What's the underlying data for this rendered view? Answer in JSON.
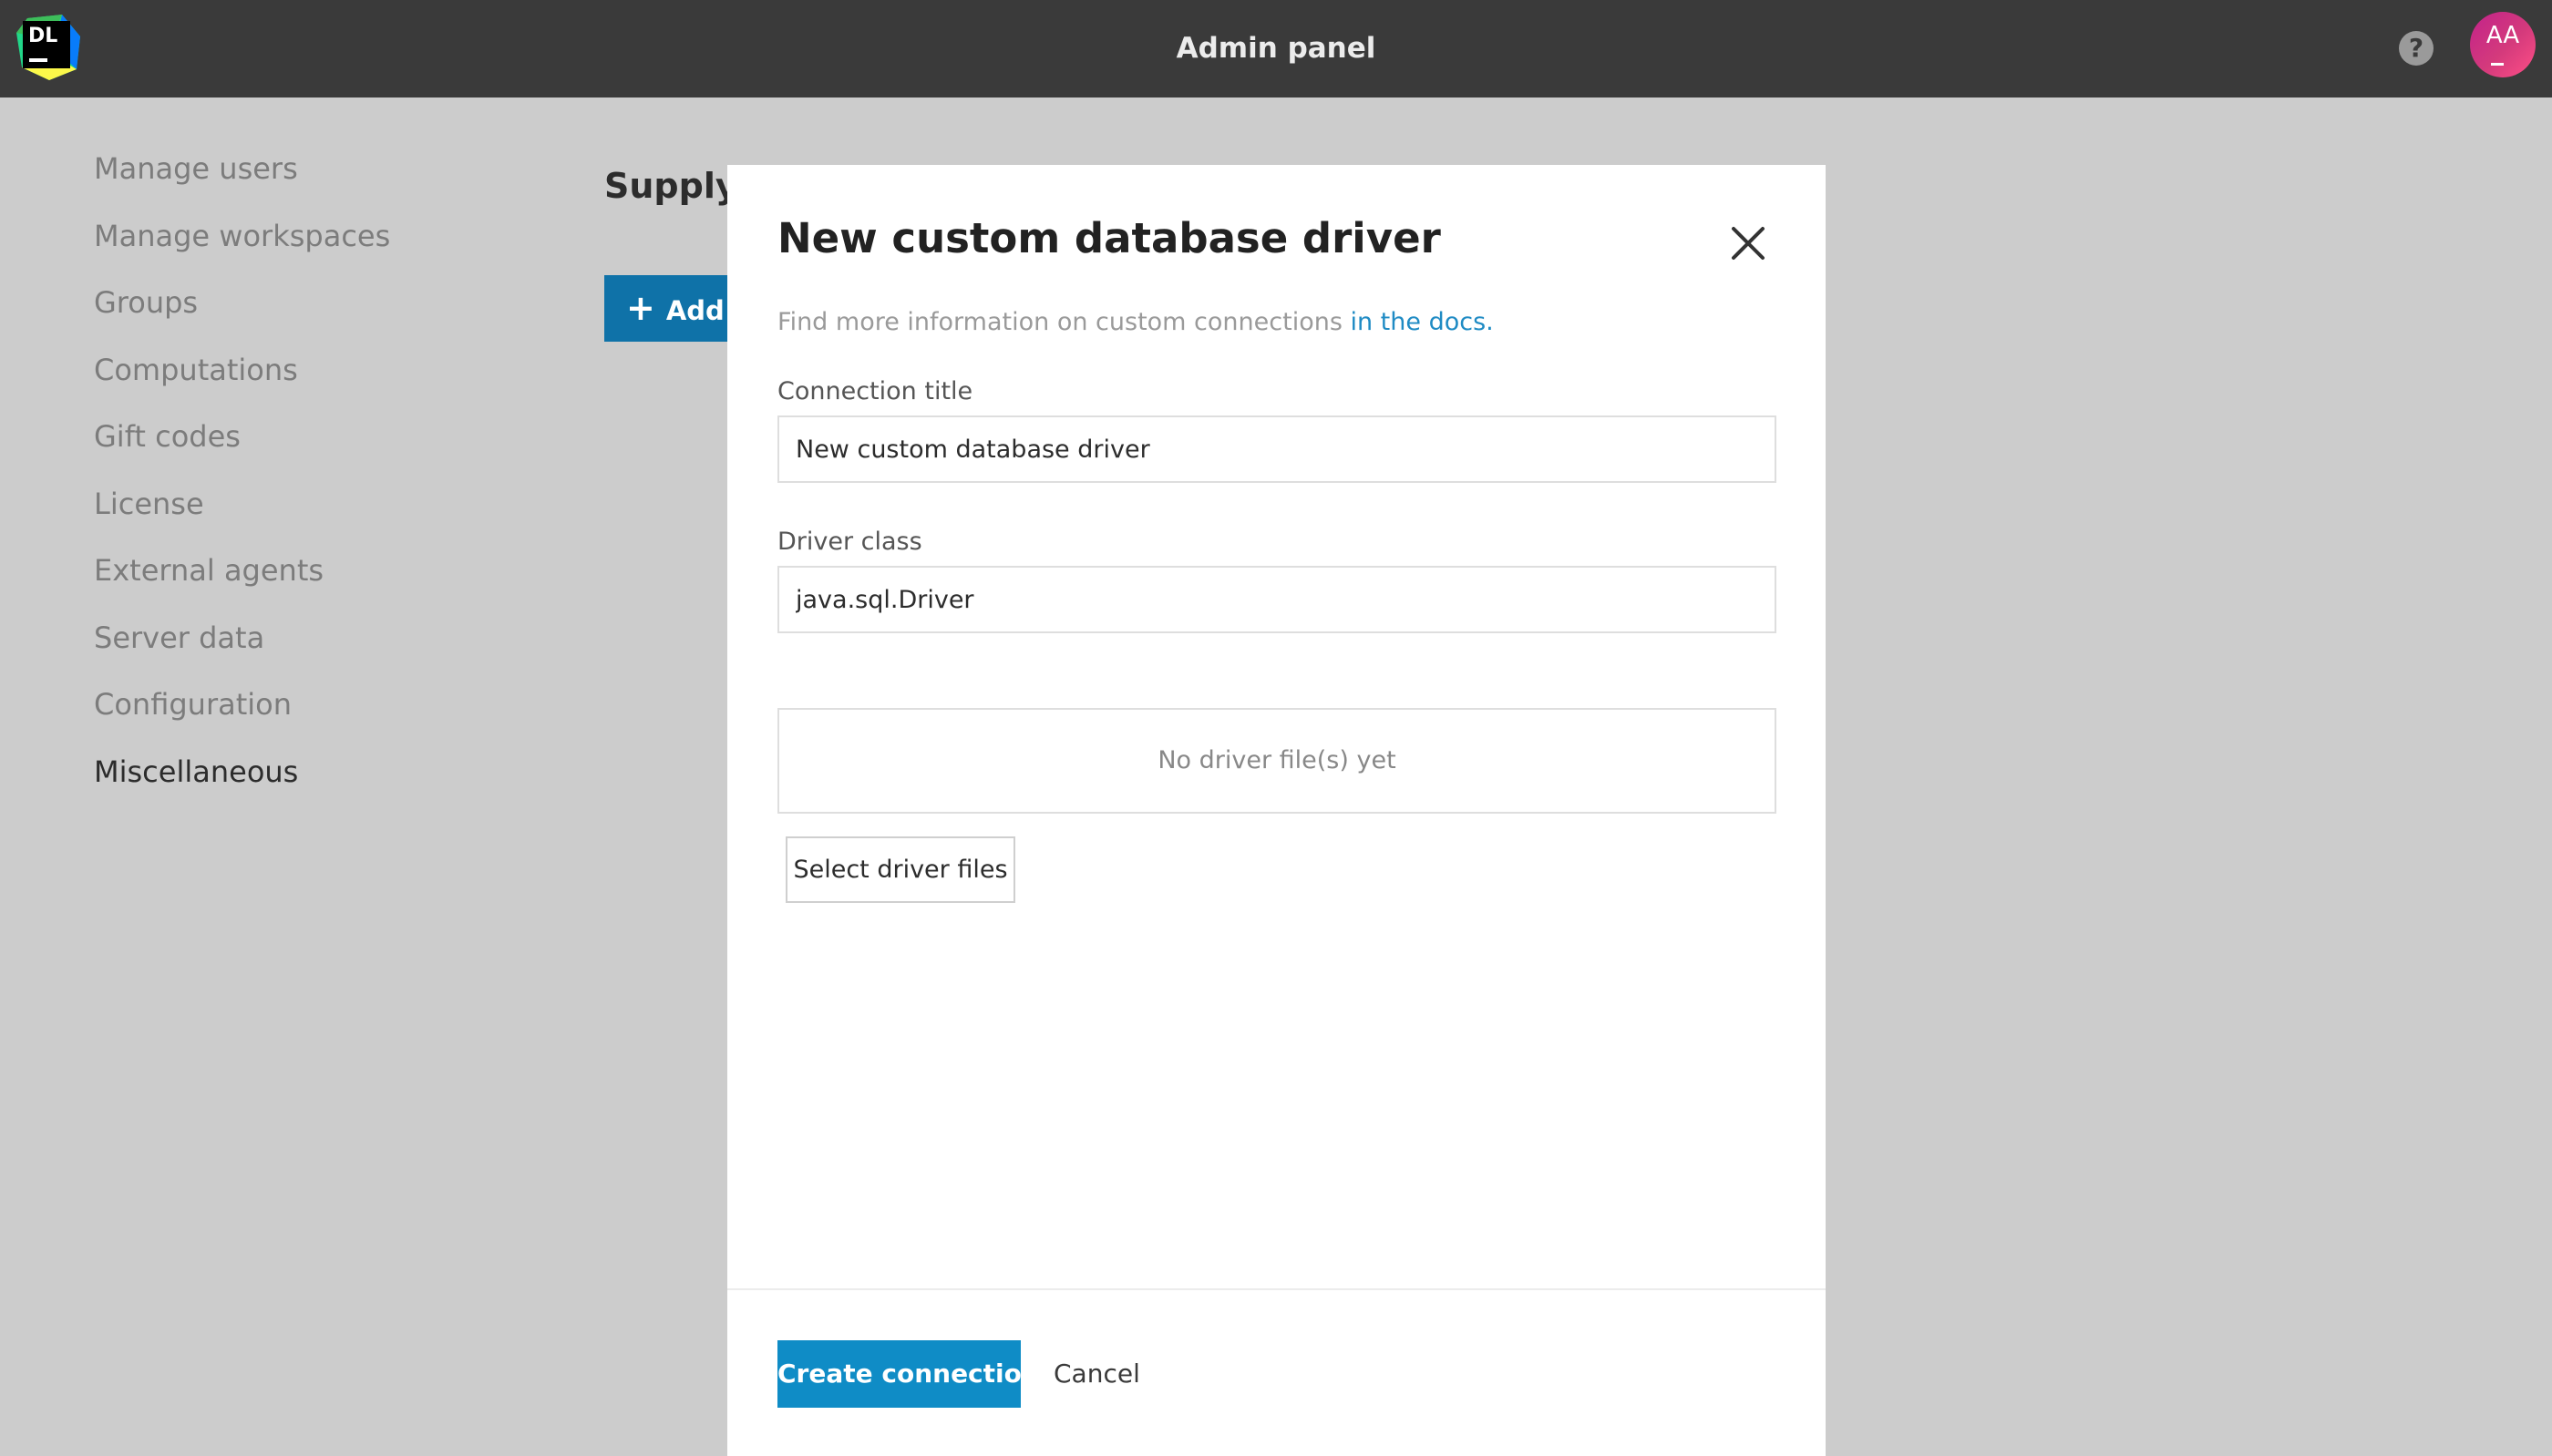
{
  "header": {
    "logo_text": "DL",
    "title": "Admin panel",
    "help_icon": "question-circle-icon",
    "avatar_initials": "AA"
  },
  "sidebar": {
    "items": [
      {
        "label": "Manage users",
        "active": false
      },
      {
        "label": "Manage workspaces",
        "active": false
      },
      {
        "label": "Groups",
        "active": false
      },
      {
        "label": "Computations",
        "active": false
      },
      {
        "label": "Gift codes",
        "active": false
      },
      {
        "label": "License",
        "active": false
      },
      {
        "label": "External agents",
        "active": false
      },
      {
        "label": "Server data",
        "active": false
      },
      {
        "label": "Configuration",
        "active": false
      },
      {
        "label": "Miscellaneous",
        "active": true
      }
    ]
  },
  "main": {
    "section_title": "Supply",
    "add_button_label": "Add c"
  },
  "modal": {
    "title": "New custom database driver",
    "hint_prefix": "Find more information on custom connections ",
    "hint_link": "in the docs",
    "hint_suffix": ".",
    "connection_title_label": "Connection title",
    "connection_title_value": "New custom database driver",
    "driver_class_label": "Driver class",
    "driver_class_value": "java.sql.Driver",
    "driver_files_empty": "No driver file(s) yet",
    "select_files_label": "Select driver files",
    "create_label": "Create connection",
    "cancel_label": "Cancel"
  },
  "colors": {
    "topbar": "#3a3a3a",
    "overlay": "#cccccc",
    "primary": "#0f8cc6",
    "link": "#1f8bc4",
    "avatar": "#d43a7c"
  }
}
